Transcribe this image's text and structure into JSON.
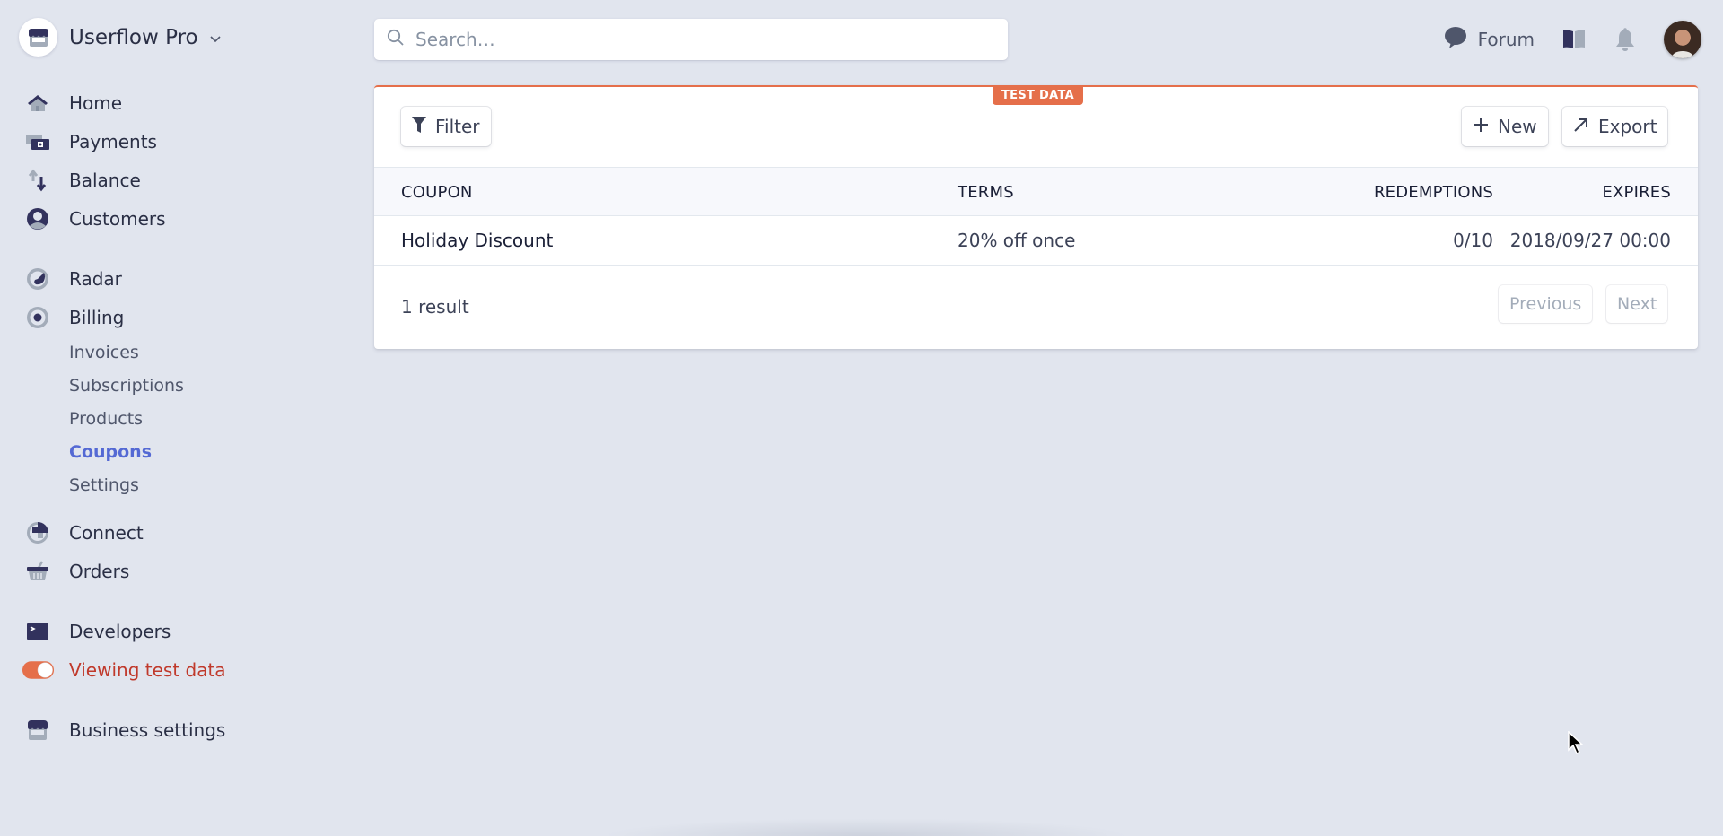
{
  "account": {
    "name": "Userflow Pro",
    "logo_icon": "storefront-icon",
    "chevron_icon": "chevron-down-icon"
  },
  "sidebar": {
    "items": [
      {
        "label": "Home",
        "icon": "home-icon"
      },
      {
        "label": "Payments",
        "icon": "payments-icon"
      },
      {
        "label": "Balance",
        "icon": "balance-arrows-icon"
      },
      {
        "label": "Customers",
        "icon": "customer-icon"
      },
      {
        "label": "Radar",
        "icon": "radar-icon"
      },
      {
        "label": "Billing",
        "icon": "billing-icon"
      },
      {
        "label": "Connect",
        "icon": "connect-icon"
      },
      {
        "label": "Orders",
        "icon": "basket-icon"
      },
      {
        "label": "Developers",
        "icon": "terminal-icon"
      },
      {
        "label": "Viewing test data",
        "icon": "toggle-icon",
        "toggle_on": true
      },
      {
        "label": "Business settings",
        "icon": "storefront-icon"
      }
    ],
    "billing_subitems": [
      {
        "label": "Invoices",
        "active": false
      },
      {
        "label": "Subscriptions",
        "active": false
      },
      {
        "label": "Products",
        "active": false
      },
      {
        "label": "Coupons",
        "active": true
      },
      {
        "label": "Settings",
        "active": false
      }
    ]
  },
  "search": {
    "placeholder": "Search…",
    "value": ""
  },
  "topbar": {
    "forum_label": "Forum",
    "docs_icon": "book-icon",
    "notifications_icon": "bell-icon",
    "avatar_icon": "user-avatar"
  },
  "card": {
    "badge": "TEST DATA",
    "filter_label": "Filter",
    "new_label": "New",
    "export_label": "Export",
    "columns": [
      "COUPON",
      "TERMS",
      "REDEMPTIONS",
      "EXPIRES"
    ],
    "rows": [
      {
        "coupon": "Holiday Discount",
        "terms": "20% off once",
        "redemptions": "0/10",
        "expires": "2018/09/27 00:00"
      }
    ],
    "result_count": "1 result",
    "previous_label": "Previous",
    "next_label": "Next"
  },
  "colors": {
    "accent": "#5469d4",
    "test_mode": "#e56f4a",
    "test_text": "#c0392b",
    "icon_dark": "#32325d",
    "icon_light": "#a3acb9"
  }
}
